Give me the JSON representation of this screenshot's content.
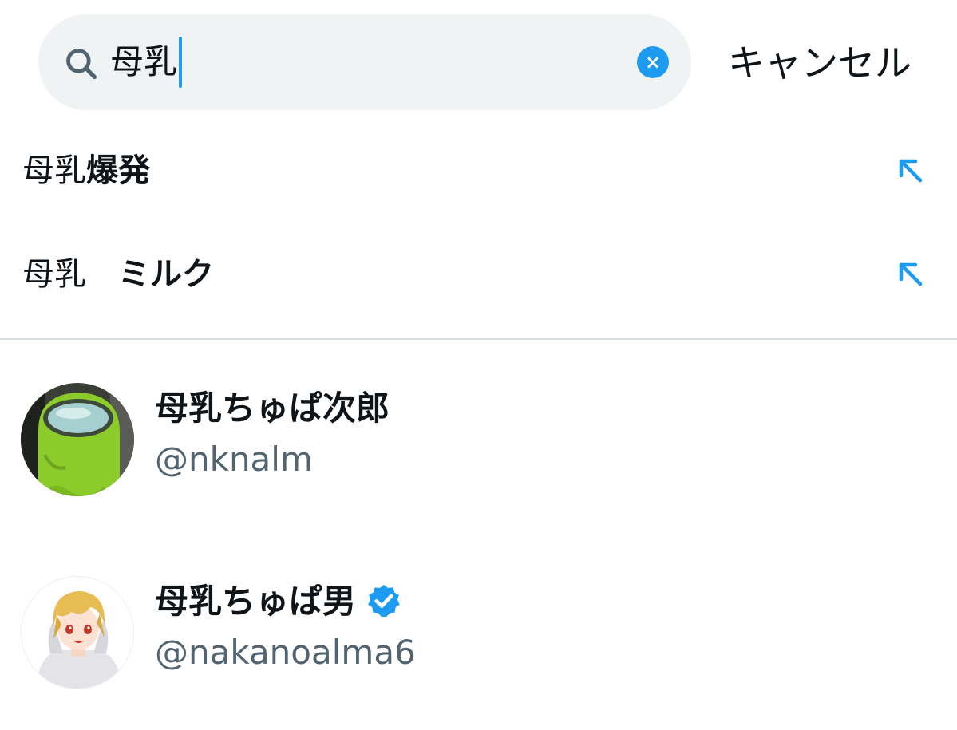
{
  "search": {
    "value": "母乳",
    "clear_label": "×",
    "cancel_label": "キャンセル"
  },
  "suggestions": [
    {
      "match": "母乳",
      "rest": "爆発",
      "arrow_icon": "arrow-up-left-icon"
    },
    {
      "match": "母乳",
      "rest": "　ミルク",
      "arrow_icon": "arrow-up-left-icon"
    }
  ],
  "users": [
    {
      "name": "母乳ちゅぱ次郎",
      "handle": "@nknalm",
      "verified": false,
      "avatar": "green-crewmate-plush-avatar"
    },
    {
      "name": "母乳ちゅぱ男",
      "handle": "@nakanoalma6",
      "verified": true,
      "avatar": "blonde-anime-character-avatar"
    }
  ],
  "colors": {
    "accent": "#1d9bf0",
    "search_bg": "#eff3f4",
    "secondary_text": "#536471",
    "divider": "#d9dee2"
  }
}
